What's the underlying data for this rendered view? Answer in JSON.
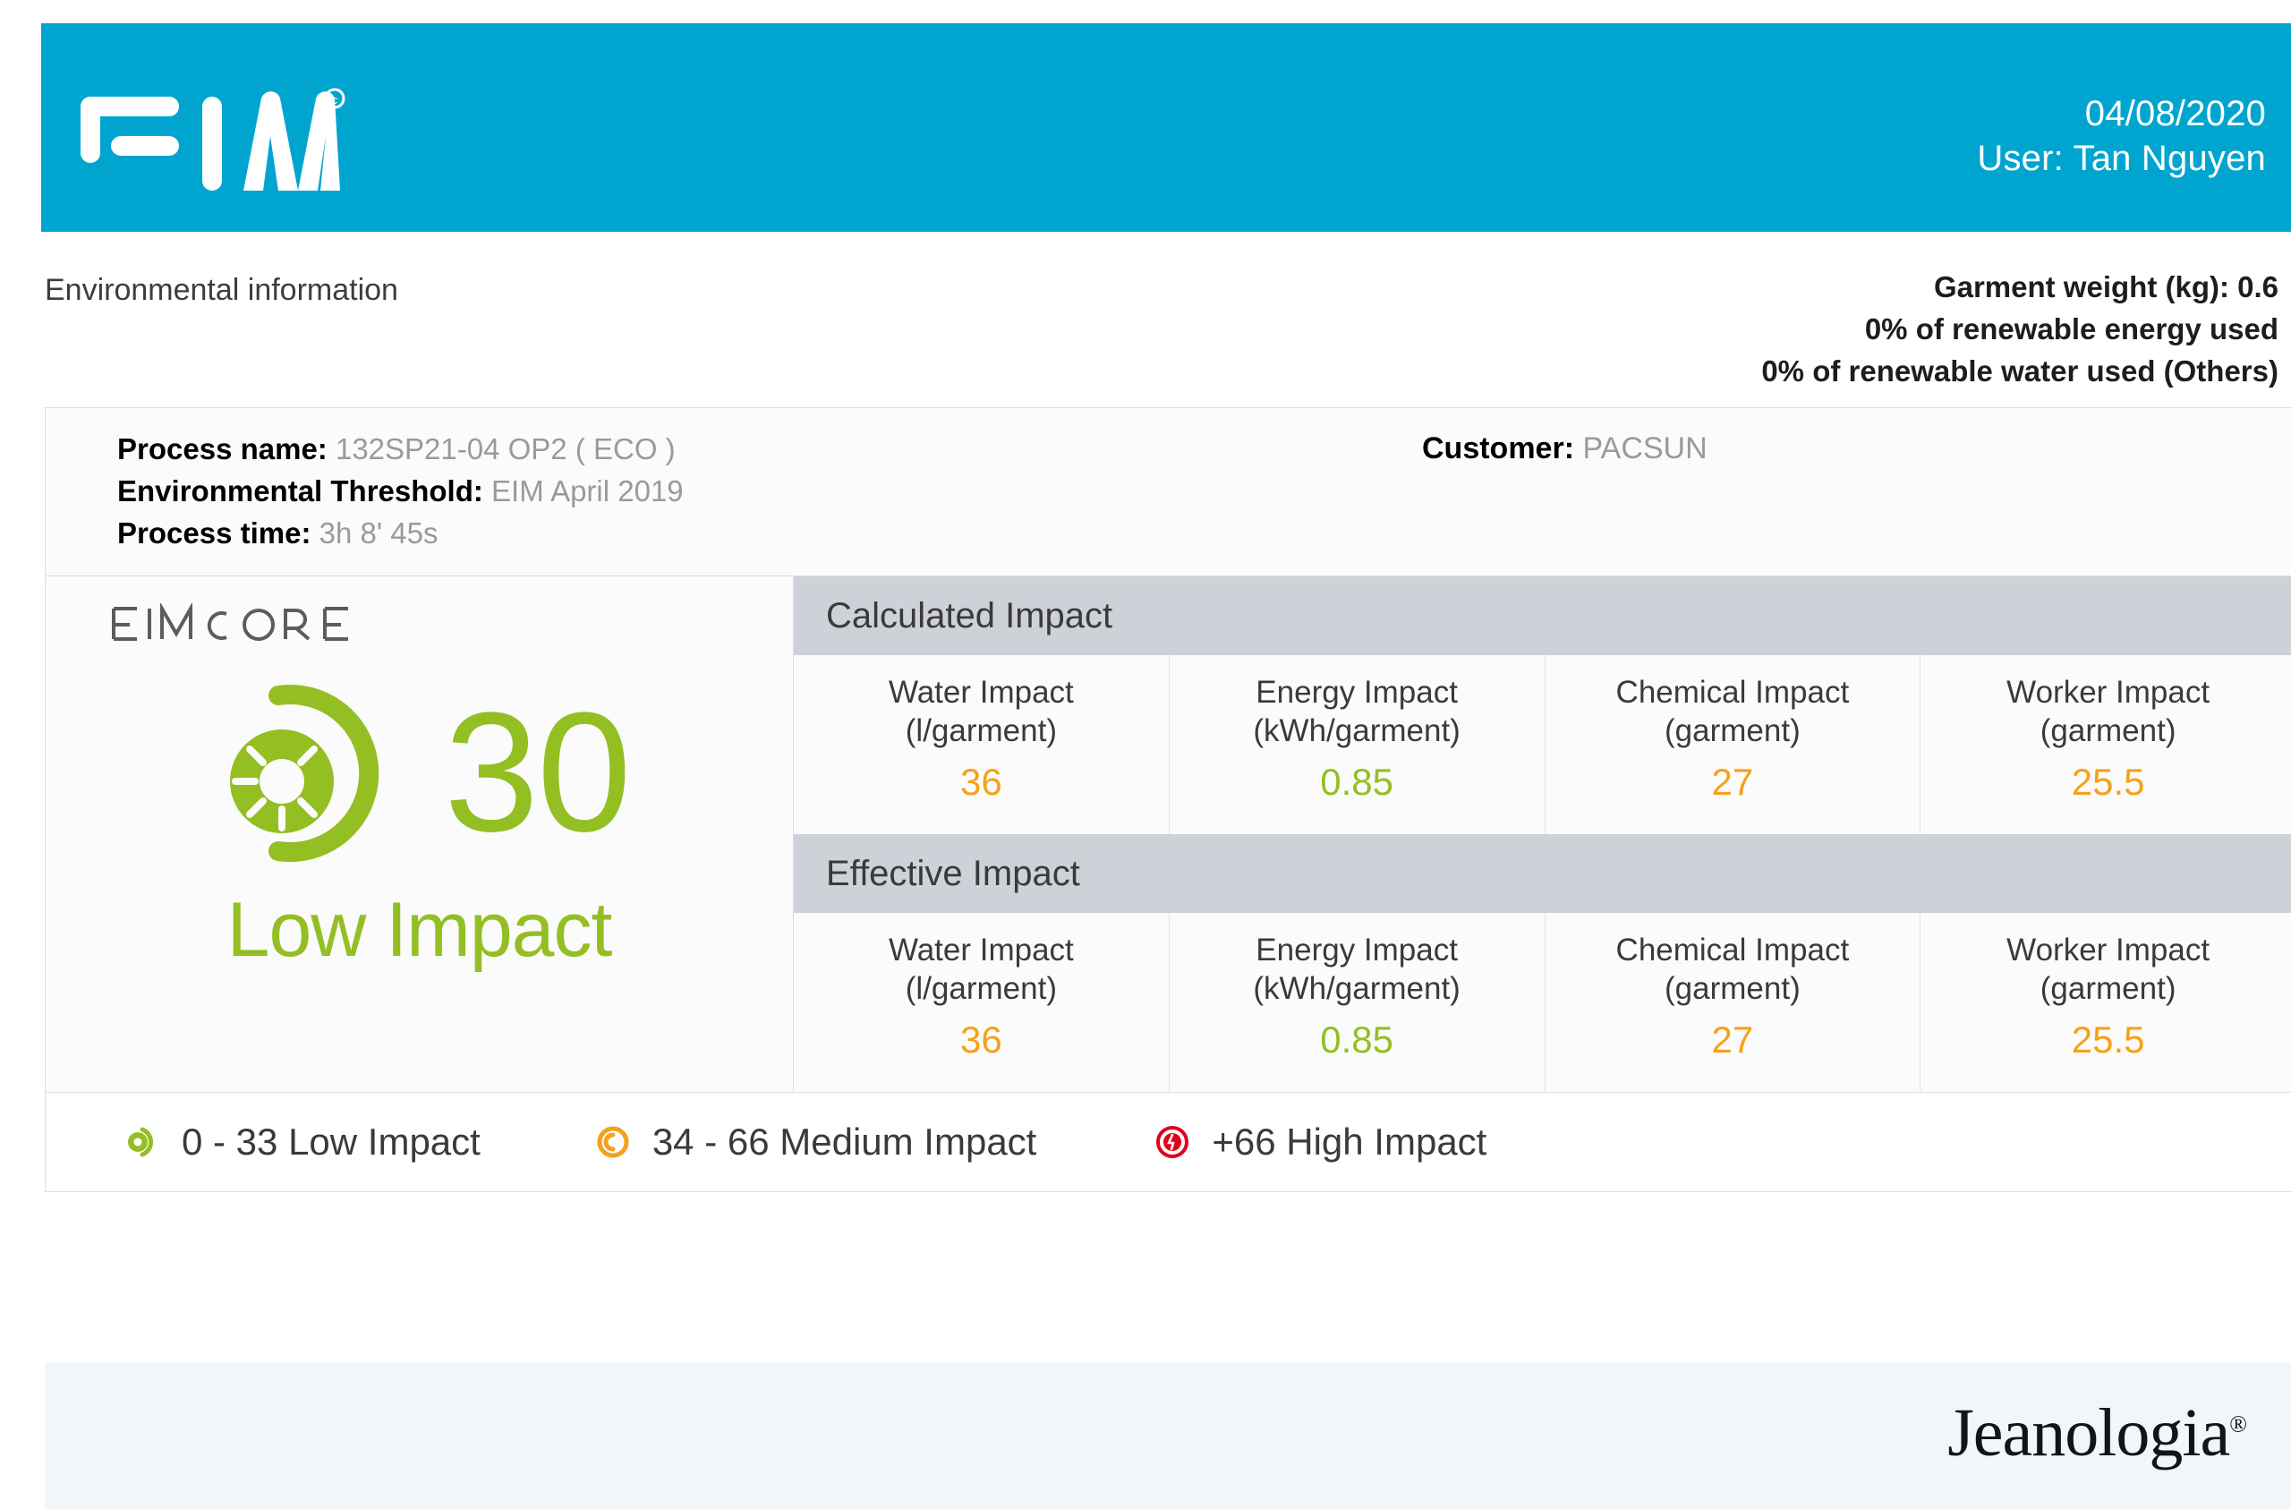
{
  "header": {
    "logo_text": "EIM",
    "logo_mark": "eim-wordmark",
    "date": "04/08/2020",
    "user": "User: Tan Nguyen",
    "bg_color": "#00a5cf"
  },
  "subinfo": {
    "left_title": "Environmental information",
    "garment_weight": "Garment weight (kg): 0.6",
    "renewable_energy": "0% of renewable energy used",
    "renewable_water": "0% of renewable water used (Others)"
  },
  "process": {
    "name_label": "Process name:",
    "name_value": "132SP21-04 OP2 ( ECO )",
    "threshold_label": "Environmental Threshold:",
    "threshold_value": "EIM April 2019",
    "time_label": "Process time:",
    "time_value": "3h 8' 45s",
    "customer_label": "Customer:",
    "customer_value": "PACSUN"
  },
  "score": {
    "title": "EIM SCORE",
    "value": "30",
    "label": "Low Impact",
    "color": "#93bf23"
  },
  "tables": [
    {
      "band": "Calculated Impact",
      "metrics": [
        {
          "name": "Water Impact",
          "unit": "(l/garment)",
          "value": "36",
          "color": "#f5a11b"
        },
        {
          "name": "Energy Impact",
          "unit": "(kWh/garment)",
          "value": "0.85",
          "color": "#93bf23"
        },
        {
          "name": "Chemical Impact",
          "unit": "(garment)",
          "value": "27",
          "color": "#f5a11b"
        },
        {
          "name": "Worker Impact",
          "unit": "(garment)",
          "value": "25.5",
          "color": "#f5a11b"
        }
      ]
    },
    {
      "band": "Effective Impact",
      "metrics": [
        {
          "name": "Water Impact",
          "unit": "(l/garment)",
          "value": "36",
          "color": "#f5a11b"
        },
        {
          "name": "Energy Impact",
          "unit": "(kWh/garment)",
          "value": "0.85",
          "color": "#93bf23"
        },
        {
          "name": "Chemical Impact",
          "unit": "(garment)",
          "value": "27",
          "color": "#f5a11b"
        },
        {
          "name": "Worker Impact",
          "unit": "(garment)",
          "value": "25.5",
          "color": "#f5a11b"
        }
      ]
    }
  ],
  "legend": [
    {
      "icon": "low-impact-icon",
      "text": "0 - 33 Low Impact",
      "color": "#93bf23"
    },
    {
      "icon": "medium-impact-icon",
      "text": "34 - 66 Medium Impact",
      "color": "#f5a11b"
    },
    {
      "icon": "high-impact-icon",
      "text": "+66 High Impact",
      "color": "#e2001a"
    }
  ],
  "footer": {
    "brand": "Jeanologia",
    "brand_mark": "®"
  }
}
